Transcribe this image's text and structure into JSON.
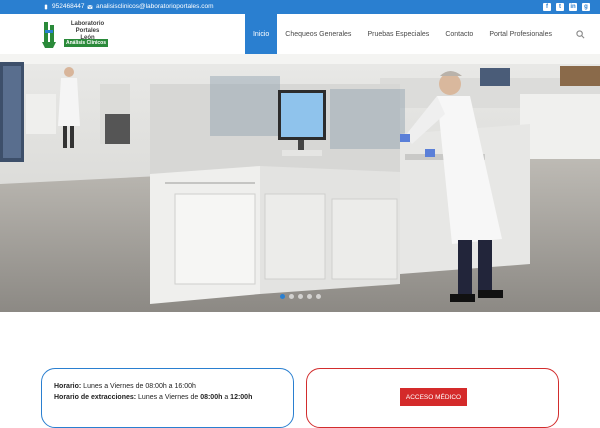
{
  "topbar": {
    "phone": "952468447",
    "email": "analisisclinicos@laboratorioportales.com",
    "social": [
      "f",
      "t",
      "in",
      "g"
    ]
  },
  "logo": {
    "line1": "Laboratorio Portales",
    "line2": "León",
    "sub": "Análisis Clínicos"
  },
  "nav": {
    "items": [
      "Inicio",
      "Chequeos Generales",
      "Pruebas Especiales",
      "Contacto",
      "Portal Profesionales"
    ]
  },
  "info": {
    "horario_label": "Horario:",
    "horario_value": " Lunes a Viernes de 08:00h a 16:00h",
    "extracciones_label": "Horario de extracciones:",
    "extracciones_pre": " Lunes a Viernes de ",
    "extracciones_from": "08:00h",
    "extracciones_mid": " a ",
    "extracciones_to": "12:00h"
  },
  "acceso_medico": "ACCESO MÉDICO",
  "colors": {
    "primary": "#2a7fd0",
    "accent": "#d42a2a",
    "logo_green": "#2a8a3a"
  }
}
